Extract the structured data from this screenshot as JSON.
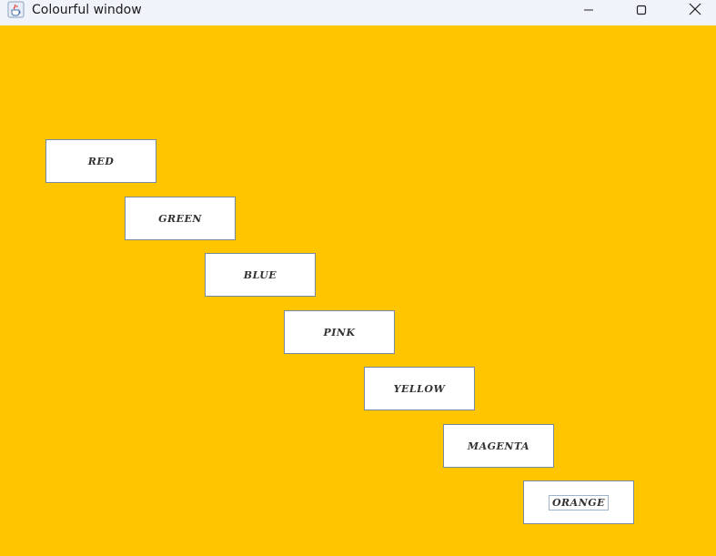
{
  "window": {
    "title": "Colourful window",
    "icon": "java-cup-icon",
    "controls": {
      "minimize": "minimize-icon",
      "maximize": "maximize-icon",
      "close": "close-icon"
    }
  },
  "content": {
    "background": "#ffc600",
    "buttons": [
      {
        "label": "RED"
      },
      {
        "label": "GREEN"
      },
      {
        "label": "BLUE"
      },
      {
        "label": "PINK"
      },
      {
        "label": "YELLOW"
      },
      {
        "label": "MAGENTA"
      },
      {
        "label": "ORANGE",
        "focused": true
      }
    ]
  }
}
